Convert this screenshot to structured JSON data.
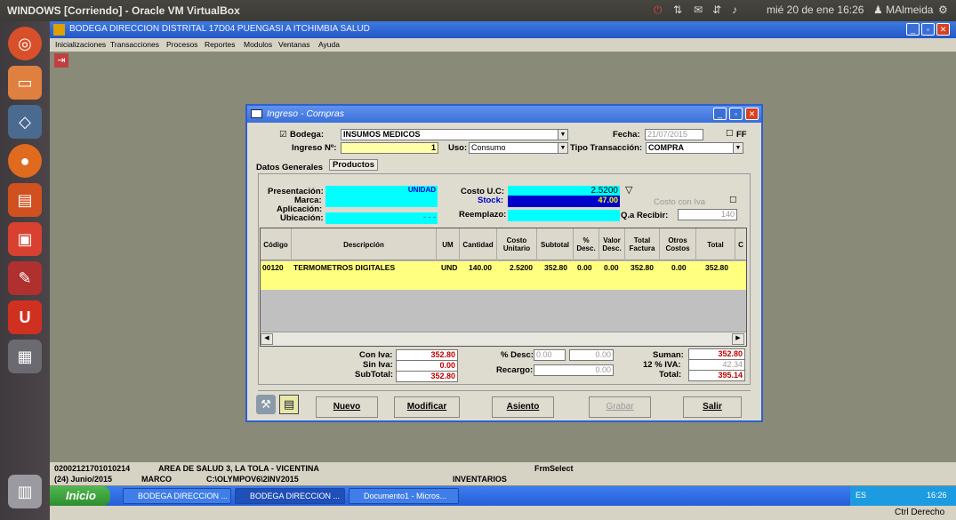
{
  "host": {
    "title": "WINDOWS [Corriendo] - Oracle VM VirtualBox",
    "datetime": "mié 20 de ene 16:26",
    "user": "MAlmeida",
    "host_key": "Ctrl Derecho"
  },
  "app": {
    "title": "BODEGA DIRECCION DISTRITAL 17D04 PUENGASI A ITCHIMBIA SALUD",
    "menu": [
      "Inicializaciones",
      "Transacciones",
      "Procesos",
      "Reportes",
      "Modulos",
      "Ventanas",
      "Ayuda"
    ]
  },
  "dialog": {
    "title": "Ingreso - Compras",
    "bodega_label": "Bodega:",
    "bodega_value": "INSUMOS MEDICOS",
    "fecha_label": "Fecha:",
    "fecha_value": "21/07/2015",
    "ff_label": "FF",
    "ingreso_label": "Ingreso Nº:",
    "ingreso_value": "1",
    "uso_label": "Uso:",
    "uso_value": "Consumo",
    "tipo_label": "Tipo Transacción:",
    "tipo_value": "COMPRA",
    "tabs": [
      "Datos Generales",
      "Productos"
    ],
    "presentacion_label": "Presentación:",
    "presentacion_value": "UNIDAD",
    "marca_label": "Marca:",
    "aplicacion_label": "Aplicación:",
    "ubicacion_label": "Ubicación:",
    "ubicacion_value": "- - -",
    "costo_uc_label": "Costo U.C:",
    "costo_uc_value": "2.5200",
    "stock_label": "Stock:",
    "stock_value": "47.00",
    "reemplazo_label": "Reemplazo:",
    "costo_iva_label": "Costo con Iva",
    "qa_recibir_label": "Q.a Recibir:",
    "qa_recibir_value": "140",
    "grid_headers": [
      "Código",
      "Descripción",
      "UM",
      "Cantidad",
      "Costo Unitario",
      "Subtotal",
      "% Desc.",
      "Valor Desc.",
      "Total Factura",
      "Otros Costos",
      "Total",
      "C"
    ],
    "grid_row": [
      "00120",
      "TERMOMETROS DIGITALES",
      "UND",
      "140.00",
      "2.5200",
      "352.80",
      "0.00",
      "0.00",
      "352.80",
      "0.00",
      "352.80"
    ],
    "con_iva_label": "Con Iva:",
    "con_iva_value": "352.80",
    "sin_iva_label": "Sin Iva:",
    "sin_iva_value": "0.00",
    "subtotal_label": "SubTotal:",
    "subtotal_value": "352.80",
    "pdesc_label": "% Desc:",
    "pdesc_value1": "0.00",
    "pdesc_value2": "0.00",
    "recargo_label": "Recargo:",
    "recargo_value": "0.00",
    "suman_label": "Suman:",
    "suman_value": "352.80",
    "iva_label": "12 % IVA:",
    "iva_value": "42.34",
    "total_label": "Total:",
    "total_value": "395.14",
    "buttons": [
      "Nuevo",
      "Modificar",
      "Asiento",
      "Grabar",
      "Salir"
    ]
  },
  "statusbar": {
    "code": "02002121701010214",
    "area": "AREA DE SALUD 3, LA TOLA - VICENTINA",
    "frm": "FrmSelect",
    "period": "(24) Junio/2015",
    "user": "MARCO",
    "path": "C:\\OLYMPOV6\\2INV2015",
    "module": "INVENTARIOS"
  },
  "taskbar": {
    "start": "Inicio",
    "tasks": [
      "BODEGA DIRECCION ...",
      "BODEGA DIRECCION ...",
      "Documento1 - Micros..."
    ],
    "lang": "ES",
    "time": "16:26"
  }
}
